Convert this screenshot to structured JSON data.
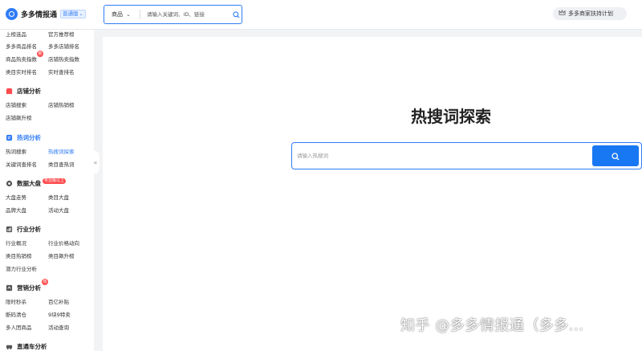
{
  "header": {
    "logo_text": "多多情报通",
    "edition": "普通版",
    "search_type": "商品",
    "search_placeholder": "请输入关键词、ID、链接",
    "support_label": "多多商家扶持计划"
  },
  "sidebar": {
    "top_rows": [
      [
        "上榜选品",
        "官方推荐榜"
      ],
      [
        "多多商品排名",
        "多多店铺排名"
      ],
      [
        "商品热卖指数",
        "店铺热卖指数"
      ],
      [
        "类目实时排名",
        "实时查排名"
      ]
    ],
    "top_badge": "新",
    "sections": [
      {
        "title": "店铺分析",
        "items": [
          [
            "店铺搜索",
            "店铺热销榜"
          ],
          [
            "店铺飙升榜",
            ""
          ]
        ]
      },
      {
        "title": "热词分析",
        "items": [
          [
            "热词搜索",
            "热搜词探索"
          ],
          [
            "关键词查排名",
            "类目查热词"
          ]
        ]
      },
      {
        "title": "数据大盘",
        "badge": "专业版以上",
        "items": [
          [
            "大盘走势",
            "类目大盘"
          ],
          [
            "品牌大盘",
            "活动大盘"
          ]
        ]
      },
      {
        "title": "行业分析",
        "items": [
          [
            "行业概况",
            "行业价格动向"
          ],
          [
            "类目热销榜",
            "类目飙升榜"
          ],
          [
            "潜力行业分析",
            ""
          ]
        ]
      },
      {
        "title": "营销分析",
        "badge": "热",
        "items": [
          [
            "限时秒杀",
            "百亿补贴"
          ],
          [
            "断码清仓",
            "9块9特卖"
          ],
          [
            "多人团商品",
            "活动查询"
          ]
        ]
      },
      {
        "title": "直通车分析",
        "items": []
      }
    ]
  },
  "main": {
    "title": "热搜词探索",
    "search_placeholder": "请输入热搜词"
  },
  "watermark": "知乎 @多多情报通（多多..."
}
